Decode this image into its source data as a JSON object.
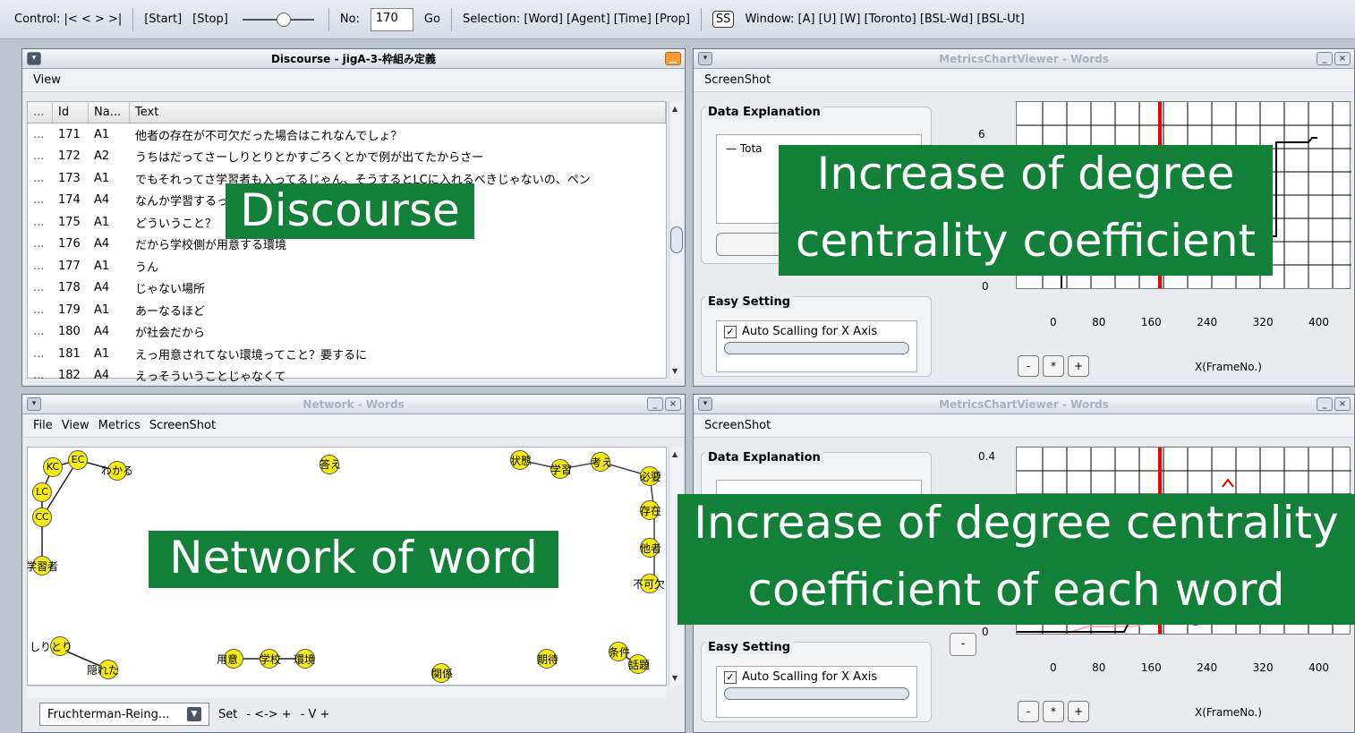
{
  "control_bar": {
    "control_label": "Control: |< < > >|",
    "start_label": "[Start]",
    "stop_label": "[Stop]",
    "no_label": "No:",
    "no_value": "170",
    "go_label": "Go",
    "selection_label": "Selection: [Word] [Agent] [Time] [Prop]",
    "ss_label": "SS",
    "window_label": "Window: [A] [U] [W] [Toronto] [BSL-Wd] [BSL-Ut]"
  },
  "discourse_window": {
    "title": "Discourse - jigA-3-枠組み定義",
    "menu_view": "View",
    "columns": [
      "...",
      "Id",
      "Na...",
      "Text"
    ],
    "rows": [
      {
        "dots": "...",
        "id": "171",
        "name": "A1",
        "text": "他者の存在が不可欠だった場合はこれなんでしょ？"
      },
      {
        "dots": "...",
        "id": "172",
        "name": "A2",
        "text": "うちはだってさーしりとりとかすごろくとかで例が出てたからさー"
      },
      {
        "dots": "...",
        "id": "173",
        "name": "A1",
        "text": "でもそれってさ学習者も入ってるじゃん、そうするとLCに入れるべきじゃないの、ペン"
      },
      {
        "dots": "...",
        "id": "174",
        "name": "A4",
        "text": "なんか学習するってことで要は線がない状態で考"
      },
      {
        "dots": "...",
        "id": "175",
        "name": "A1",
        "text": "どういうこと？"
      },
      {
        "dots": "...",
        "id": "176",
        "name": "A4",
        "text": "だから学校側が用意する環境"
      },
      {
        "dots": "...",
        "id": "177",
        "name": "A1",
        "text": "うん"
      },
      {
        "dots": "...",
        "id": "178",
        "name": "A4",
        "text": "じゃない場所"
      },
      {
        "dots": "...",
        "id": "179",
        "name": "A1",
        "text": "あーなるほど"
      },
      {
        "dots": "...",
        "id": "180",
        "name": "A4",
        "text": "が社会だから"
      },
      {
        "dots": "...",
        "id": "181",
        "name": "A1",
        "text": "えっ用意されてない環境ってこと？要するに"
      },
      {
        "dots": "...",
        "id": "182",
        "name": "A4",
        "text": "えっそういうことじゃなくて"
      }
    ]
  },
  "network_window": {
    "title": "Network - Words",
    "menu": [
      "File",
      "View",
      "Metrics",
      "ScreenShot"
    ],
    "nodes": [
      "KC",
      "EC",
      "わかる",
      "LC",
      "CC",
      "学習者",
      "答え",
      "状態",
      "学習",
      "考え",
      "必要",
      "存在",
      "他者",
      "不可欠",
      "しりとり",
      "隠れた",
      "用意",
      "学校",
      "環境",
      "関係",
      "期待",
      "条件",
      "話題"
    ],
    "layout_name": "Fruchterman-Reing...",
    "set_label": "Set",
    "zoom_controls": "- <-> +",
    "v_controls": "- V +"
  },
  "metrics_top": {
    "title": "MetricsChartViewer - Words",
    "menu_screenshot": "ScreenShot",
    "data_explanation": "Data Explanation",
    "legend_total": "Tota",
    "easy_setting": "Easy Setting",
    "auto_scaling_x": "Auto Scalling for X Axis",
    "y_tick_top": "6",
    "y_tick_bottom": "0",
    "x_ticks": [
      "0",
      "80",
      "160",
      "240",
      "320",
      "400"
    ],
    "x_label": "X(FrameNo.)",
    "buttons": [
      "-",
      "*",
      "+"
    ]
  },
  "metrics_bottom": {
    "title": "MetricsChartViewer - Words",
    "menu_screenshot": "ScreenShot",
    "data_explanation": "Data Explanation",
    "easy_setting": "Easy Setting",
    "auto_scaling_x": "Auto Scalling for X Axis",
    "y_tick_top": "0.4",
    "y_tick_bottom": "0",
    "x_ticks": [
      "0",
      "80",
      "160",
      "240",
      "320",
      "400"
    ],
    "x_label": "X(FrameNo.)",
    "buttons": [
      "-",
      "*",
      "+"
    ]
  },
  "callouts": {
    "discourse": "Discourse",
    "network": "Network of word",
    "increase_1": "Increase of degree",
    "increase_2": "centrality coefficient",
    "each_1": "Increase of degree centrality",
    "each_2": "coefficient of each word"
  },
  "colors": {
    "callout_bg": "#13803a",
    "node_fill": "#f5eb10",
    "highlight_red": "#e00000",
    "cursor_line": "#e00000"
  }
}
